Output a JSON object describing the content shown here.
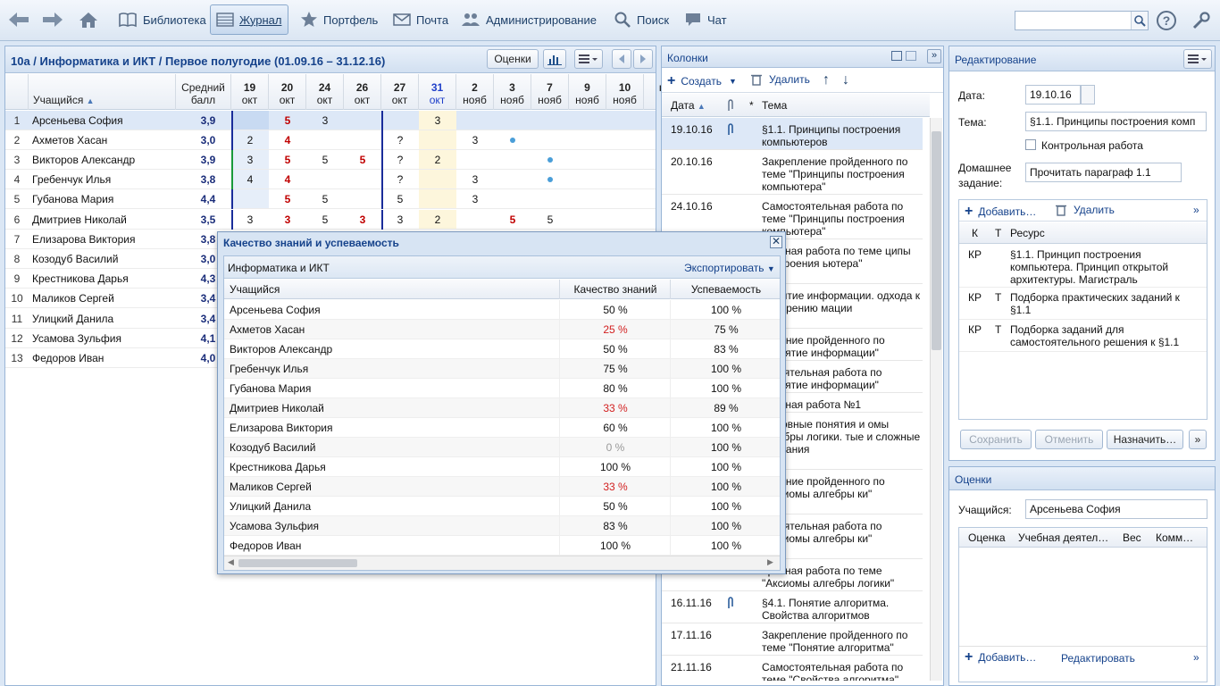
{
  "nav": {
    "items": [
      {
        "label": "Библиотека",
        "icon": "book-icon"
      },
      {
        "label": "Журнал",
        "icon": "journal-icon",
        "active": true
      },
      {
        "label": "Портфель",
        "icon": "star-icon"
      },
      {
        "label": "Почта",
        "icon": "mail-icon"
      },
      {
        "label": "Администрирование",
        "icon": "users-icon"
      },
      {
        "label": "Поиск",
        "icon": "search-icon"
      },
      {
        "label": "Чат",
        "icon": "chat-icon"
      }
    ],
    "search_value": ""
  },
  "journal": {
    "title": "10а / Информатика и ИКТ / Первое полугодие (01.09.16 – 31.12.16)",
    "grades_button": "Оценки",
    "col_student": "Учащийся",
    "col_avg": "Средний балл",
    "dates": [
      {
        "d": "19",
        "m": "окт"
      },
      {
        "d": "20",
        "m": "окт"
      },
      {
        "d": "24",
        "m": "окт"
      },
      {
        "d": "26",
        "m": "окт"
      },
      {
        "d": "27",
        "m": "окт"
      },
      {
        "d": "31",
        "m": "окт"
      },
      {
        "d": "2",
        "m": "нояб"
      },
      {
        "d": "3",
        "m": "нояб"
      },
      {
        "d": "7",
        "m": "нояб"
      },
      {
        "d": "9",
        "m": "нояб"
      },
      {
        "d": "10",
        "m": "нояб"
      },
      {
        "d": "н",
        "m": ""
      }
    ],
    "students": [
      {
        "n": "1",
        "name": "Арсеньева София",
        "avg": "3,9",
        "g": [
          "",
          "5",
          "3",
          "",
          "",
          "3",
          "",
          "",
          "",
          "",
          ""
        ]
      },
      {
        "n": "2",
        "name": "Ахметов Хасан",
        "avg": "3,0",
        "g": [
          "2",
          "4",
          "",
          "",
          "?",
          "",
          "3",
          "",
          "",
          "",
          ""
        ]
      },
      {
        "n": "3",
        "name": "Викторов Александр",
        "avg": "3,9",
        "g": [
          "3",
          "5",
          "5",
          "5",
          "?",
          "2",
          "",
          "",
          "",
          "",
          ""
        ]
      },
      {
        "n": "4",
        "name": "Гребенчук Илья",
        "avg": "3,8",
        "g": [
          "4",
          "4",
          "",
          "",
          "?",
          "",
          "3",
          "",
          "",
          "",
          ""
        ]
      },
      {
        "n": "5",
        "name": "Губанова Мария",
        "avg": "4,4",
        "g": [
          "",
          "5",
          "5",
          "",
          "5",
          "",
          "3",
          "",
          "",
          "",
          ""
        ]
      },
      {
        "n": "6",
        "name": "Дмитриев Николай",
        "avg": "3,5",
        "g": [
          "3",
          "3",
          "5",
          "3",
          "3",
          "2",
          "",
          "5",
          "5",
          "",
          ""
        ]
      },
      {
        "n": "7",
        "name": "Елизарова Виктория",
        "avg": "3,8",
        "g": []
      },
      {
        "n": "8",
        "name": "Козодуб Василий",
        "avg": "3,0",
        "g": []
      },
      {
        "n": "9",
        "name": "Крестникова Дарья",
        "avg": "4,3",
        "g": []
      },
      {
        "n": "10",
        "name": "Маликов Сергей",
        "avg": "3,4",
        "g": []
      },
      {
        "n": "11",
        "name": "Улицкий Данила",
        "avg": "3,4",
        "g": []
      },
      {
        "n": "12",
        "name": "Усамова Зульфия",
        "avg": "4,1",
        "g": []
      },
      {
        "n": "13",
        "name": "Федоров Иван",
        "avg": "4,0",
        "g": []
      }
    ]
  },
  "modal": {
    "title": "Качество знаний и успеваемость",
    "subject": "Информатика и ИКТ",
    "export_label": "Экспортировать",
    "col_student": "Учащийся",
    "col_quality": "Качество знаний",
    "col_progress": "Успеваемость",
    "rows": [
      {
        "name": "Арсеньева София",
        "q": "50 %",
        "u": "100 %",
        "qc": "normal"
      },
      {
        "name": "Ахметов Хасан",
        "q": "25 %",
        "u": "75 %",
        "qc": "red"
      },
      {
        "name": "Викторов Александр",
        "q": "50 %",
        "u": "83 %",
        "qc": "normal"
      },
      {
        "name": "Гребенчук Илья",
        "q": "75 %",
        "u": "100 %",
        "qc": "normal"
      },
      {
        "name": "Губанова Мария",
        "q": "80 %",
        "u": "100 %",
        "qc": "normal"
      },
      {
        "name": "Дмитриев Николай",
        "q": "33 %",
        "u": "89 %",
        "qc": "red"
      },
      {
        "name": "Елизарова Виктория",
        "q": "60 %",
        "u": "100 %",
        "qc": "normal"
      },
      {
        "name": "Козодуб Василий",
        "q": "0 %",
        "u": "100 %",
        "qc": "gray"
      },
      {
        "name": "Крестникова Дарья",
        "q": "100 %",
        "u": "100 %",
        "qc": "normal"
      },
      {
        "name": "Маликов Сергей",
        "q": "33 %",
        "u": "100 %",
        "qc": "red"
      },
      {
        "name": "Улицкий Данила",
        "q": "50 %",
        "u": "100 %",
        "qc": "normal"
      },
      {
        "name": "Усамова Зульфия",
        "q": "83 %",
        "u": "100 %",
        "qc": "normal"
      },
      {
        "name": "Федоров Иван",
        "q": "100 %",
        "u": "100 %",
        "qc": "normal"
      }
    ]
  },
  "columns": {
    "title": "Колонки",
    "create_label": "Создать",
    "delete_label": "Удалить",
    "col_date": "Дата",
    "col_star": "*",
    "col_topic": "Тема",
    "rows": [
      {
        "date": "19.10.16",
        "topic": "§1.1. Принципы построения компьютеров",
        "clip": true
      },
      {
        "date": "20.10.16",
        "topic": "Закрепление пройденного по теме \"Принципы построения компьютера\"",
        "clip": false
      },
      {
        "date": "24.10.16",
        "topic": "Самостоятельная работа по теме \"Принципы построения компьютера\"",
        "clip": false
      },
      {
        "date": "",
        "topic": "ерочная работа по теме ципы построения ьютера\"",
        "clip": false
      },
      {
        "date": "",
        "topic": "Понятие информации. одхода к измерению мации",
        "clip": false
      },
      {
        "date": "",
        "topic": "епление пройденного по \"Понятие информации\"",
        "clip": false
      },
      {
        "date": "",
        "topic": "остоятельная работа по \"Понятие информации\"",
        "clip": false
      },
      {
        "date": "",
        "topic": "рольная работа №1",
        "clip": false
      },
      {
        "date": "",
        "topic": "Основные понятия и омы алгебры логики. тые и сложные азывания",
        "clip": false
      },
      {
        "date": "",
        "topic": "епление пройденного по \"Аксиомы алгебры ки\"",
        "clip": false
      },
      {
        "date": "",
        "topic": "остоятельная работа по \"Аксиомы алгебры ки\"",
        "clip": false
      },
      {
        "date": "",
        "topic": "ерочная работа по теме \"Аксиомы алгебры логики\"",
        "clip": false
      },
      {
        "date": "16.11.16",
        "topic": "§4.1. Понятие алгоритма. Свойства алгоритмов",
        "clip": true
      },
      {
        "date": "17.11.16",
        "topic": "Закрепление пройденного по теме \"Понятие алгоритма\"",
        "clip": false
      },
      {
        "date": "21.11.16",
        "topic": "Самостоятельная работа по теме \"Свойства алгоритма\"",
        "clip": false
      }
    ]
  },
  "edit": {
    "title": "Редактирование",
    "date_label": "Дата:",
    "date_value": "19.10.16",
    "topic_label": "Тема:",
    "topic_value": "§1.1. Принципы построения комп",
    "control_label": "Контрольная работа",
    "hw_label1": "Домашнее",
    "hw_label2": "задание:",
    "hw_value": "Прочитать параграф 1.1",
    "add_label": "Добавить…",
    "delete_label": "Удалить",
    "col_k": "К",
    "col_t": "Т",
    "col_res": "Ресурс",
    "resources": [
      {
        "k": "КР",
        "t": "",
        "res": "§1.1. Принцип построения компьютера. Принцип открытой архитектуры. Магистраль"
      },
      {
        "k": "КР",
        "t": "Т",
        "res": "Подборка практических заданий к §1.1"
      },
      {
        "k": "КР",
        "t": "Т",
        "res": "Подборка заданий для самостоятельного решения к §1.1"
      }
    ],
    "save_label": "Сохранить",
    "cancel_label": "Отменить",
    "assign_label": "Назначить…"
  },
  "grades": {
    "title": "Оценки",
    "student_label": "Учащийся:",
    "student_value": "Арсеньева София",
    "col_grade": "Оценка",
    "col_activity": "Учебная деятел…",
    "col_weight": "Вес",
    "col_comment": "Комм…",
    "add_label": "Добавить…",
    "edit_label": "Редактировать"
  }
}
